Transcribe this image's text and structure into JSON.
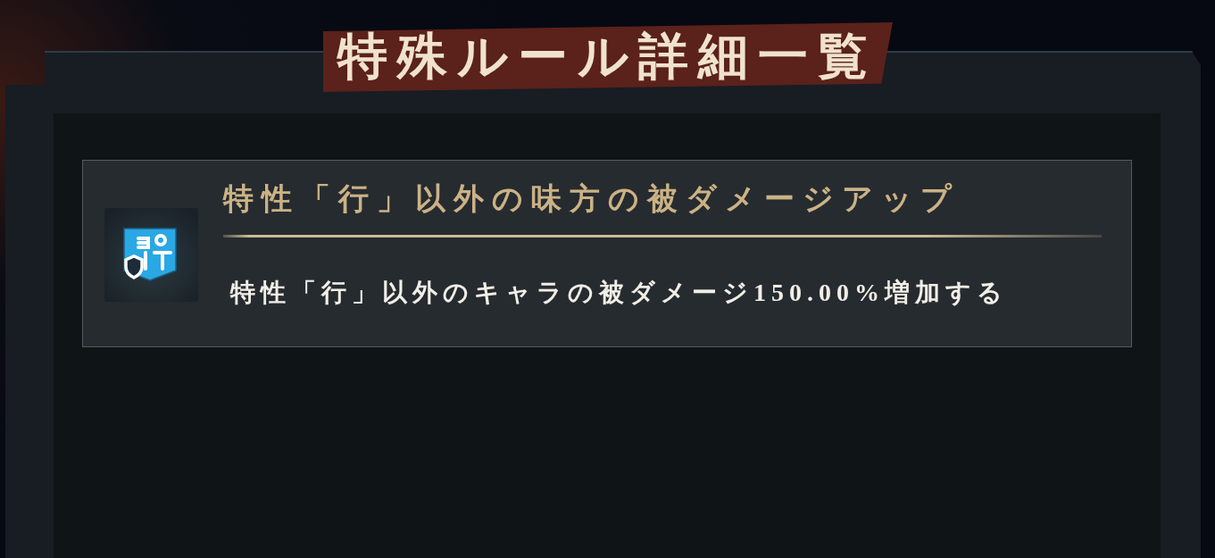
{
  "title": "特殊ルール詳細一覧",
  "rules": [
    {
      "title": "特性「行」以外の味方の被ダメージアップ",
      "description": "特性「行」以外のキャラの被ダメージ150.00%増加する"
    }
  ]
}
